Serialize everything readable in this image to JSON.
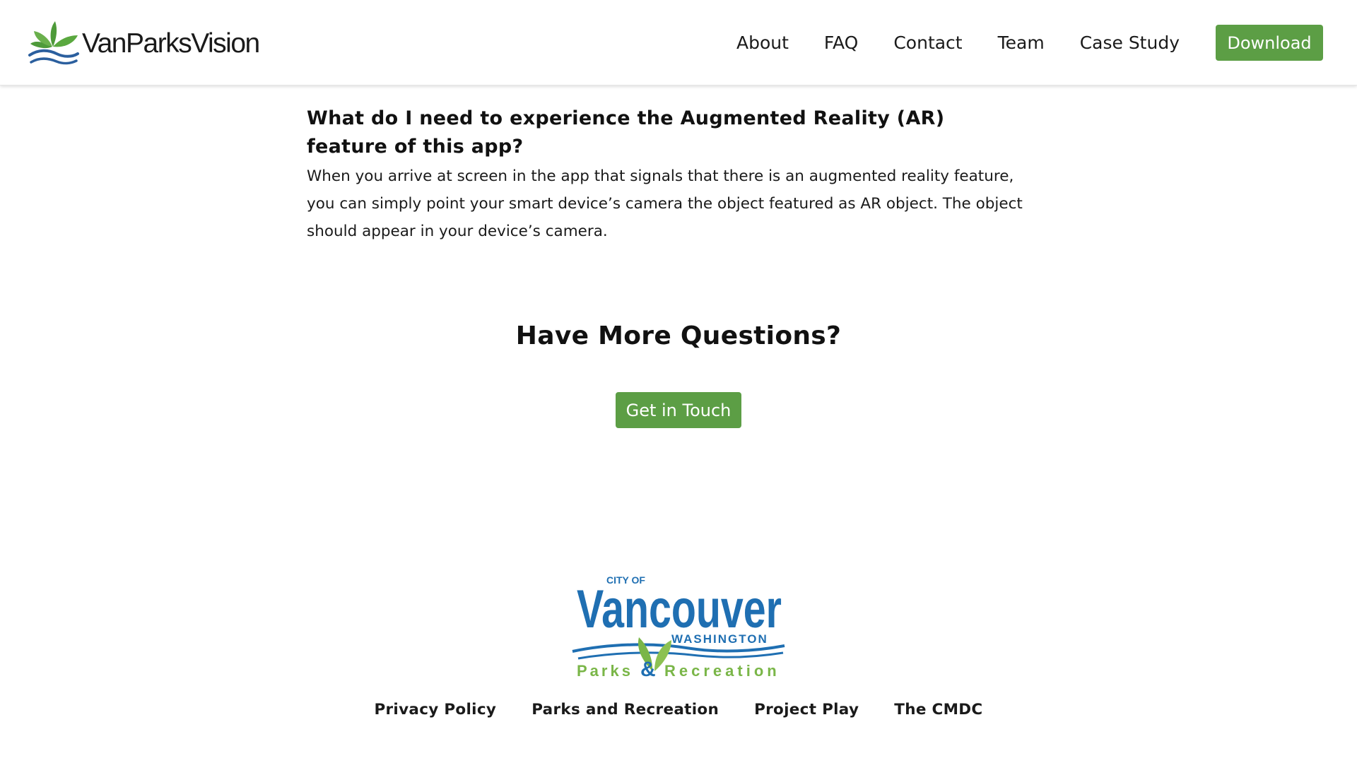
{
  "header": {
    "logo_text": "VanParksVision",
    "nav": [
      "About",
      "FAQ",
      "Contact",
      "Team",
      "Case Study"
    ],
    "download_label": "Download"
  },
  "faq": {
    "question": "What do I need to experience the Augmented Reality (AR) feature of this app?",
    "answer": "When you arrive at screen in the app that signals that there is an augmented reality feature, you can simply point your smart device’s camera the object featured as AR object. The object should appear in your device’s camera."
  },
  "cta": {
    "title": "Have More Questions?",
    "button_label": "Get in Touch"
  },
  "footer": {
    "logo": {
      "city_of": "CITY OF",
      "city": "Vancouver",
      "state": "WASHINGTON",
      "parks": "Parks",
      "ampersand": "&",
      "recreation": "Recreation"
    },
    "links": [
      "Privacy Policy",
      "Parks and Recreation",
      "Project Play",
      "The CMDC"
    ]
  },
  "colors": {
    "accent_green": "#5c9e45",
    "leaf_green": "#6ab04c",
    "water_blue": "#2b5f9e",
    "vancouver_blue": "#1f6fb2"
  },
  "icons": [
    "leaf-logo-icon",
    "vancouver-parks-logo"
  ]
}
